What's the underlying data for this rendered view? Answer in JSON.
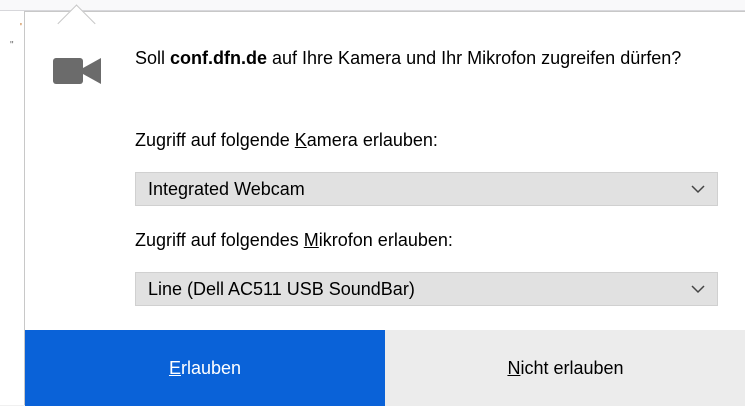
{
  "background": {
    "marks": [
      "'",
      "\""
    ]
  },
  "dialog": {
    "icon": "camera-icon",
    "message_prefix": "Soll ",
    "domain": "conf.dfn.de",
    "message_suffix": " auf Ihre Kamera und Ihr Mikrofon zugreifen dürfen?",
    "camera_label_before": "Zugriff auf folgende ",
    "camera_label_access": "K",
    "camera_label_after": "amera erlauben:",
    "camera_selected": "Integrated Webcam",
    "mic_label_before": "Zugriff auf folgendes ",
    "mic_label_access": "M",
    "mic_label_after": "ikrofon erlauben:",
    "mic_selected": "Line (Dell AC511 USB SoundBar)"
  },
  "buttons": {
    "allow_access": "E",
    "allow_rest": "rlauben",
    "deny_access": "N",
    "deny_rest": "icht erlauben"
  },
  "colors": {
    "primary": "#0a62d8",
    "select_bg": "#e1e1e1",
    "secondary_btn": "#ececec"
  }
}
